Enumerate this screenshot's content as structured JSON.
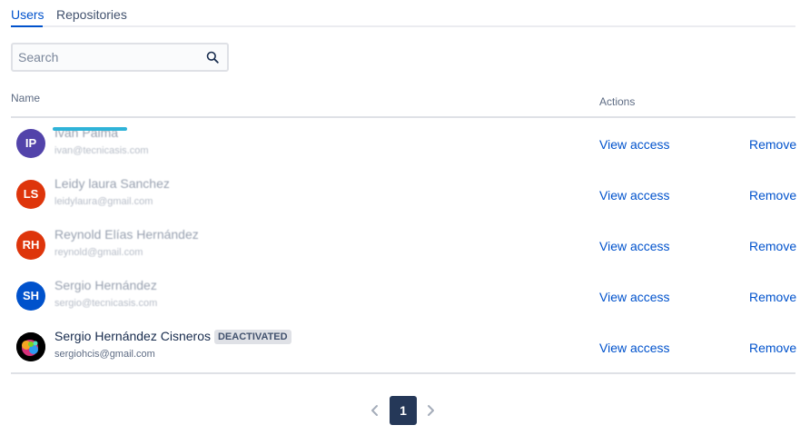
{
  "tabs": [
    {
      "label": "Users",
      "active": true
    },
    {
      "label": "Repositories",
      "active": false
    }
  ],
  "search": {
    "placeholder": "Search",
    "value": "",
    "icon": "search-icon"
  },
  "table": {
    "columns": {
      "name": "Name",
      "actions": "Actions"
    },
    "rows": [
      {
        "initials": "IP",
        "avatar_color": "#5243aa",
        "name": "Ivan Palma",
        "email": "ivan@tecnicasis.com",
        "status": "",
        "view_label": "View access",
        "remove_label": "Remove"
      },
      {
        "initials": "LS",
        "avatar_color": "#de350b",
        "name": "Leidy laura Sanchez",
        "email": "leidylaura@gmail.com",
        "status": "",
        "view_label": "View access",
        "remove_label": "Remove"
      },
      {
        "initials": "RH",
        "avatar_color": "#de350b",
        "name": "Reynold Elías Hernández",
        "email": "reynold@gmail.com",
        "status": "",
        "view_label": "View access",
        "remove_label": "Remove"
      },
      {
        "initials": "SH",
        "avatar_color": "#0052cc",
        "name": "Sergio Hernández",
        "email": "sergio@tecnicasis.com",
        "status": "",
        "view_label": "View access",
        "remove_label": "Remove"
      },
      {
        "initials": "",
        "avatar_color": "#000000",
        "name": "Sergio Hernández Cisneros",
        "email": "sergiohcis@gmail.com",
        "status": "DEACTIVATED",
        "view_label": "View access",
        "remove_label": "Remove"
      }
    ]
  },
  "pagination": {
    "current_page": "1",
    "prev_icon": "chevron-left-icon",
    "next_icon": "chevron-right-icon"
  },
  "colors": {
    "link": "#0052cc",
    "active_page": "#253858",
    "badge_bg": "#dfe1e6"
  }
}
